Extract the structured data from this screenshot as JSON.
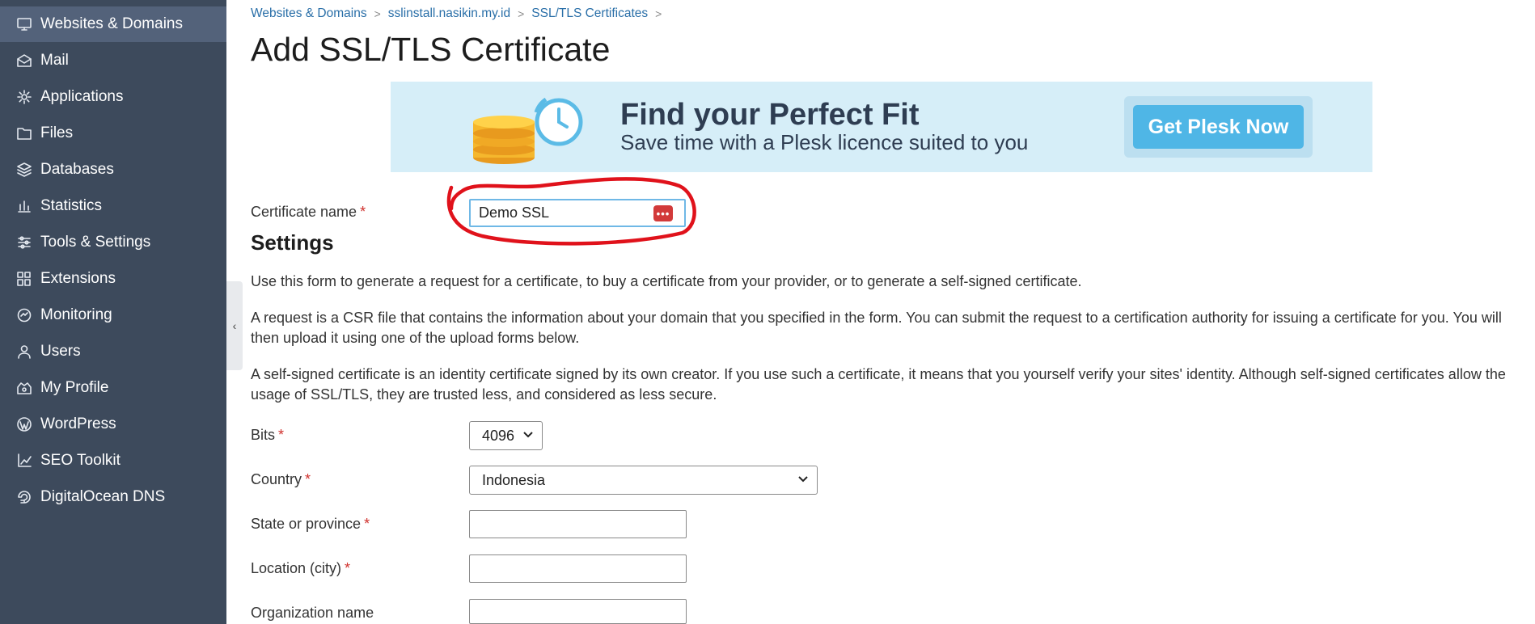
{
  "sidebar": {
    "items": [
      {
        "label": "Websites & Domains",
        "icon": "monitor-icon"
      },
      {
        "label": "Mail",
        "icon": "mail-icon"
      },
      {
        "label": "Applications",
        "icon": "gear-icon"
      },
      {
        "label": "Files",
        "icon": "folder-icon"
      },
      {
        "label": "Databases",
        "icon": "database-icon"
      },
      {
        "label": "Statistics",
        "icon": "bar-chart-icon"
      },
      {
        "label": "Tools & Settings",
        "icon": "sliders-icon"
      },
      {
        "label": "Extensions",
        "icon": "puzzle-icon"
      },
      {
        "label": "Monitoring",
        "icon": "monitoring-icon"
      },
      {
        "label": "Users",
        "icon": "user-icon"
      },
      {
        "label": "My Profile",
        "icon": "profile-icon"
      },
      {
        "label": "WordPress",
        "icon": "wordpress-icon"
      },
      {
        "label": "SEO Toolkit",
        "icon": "seo-chart-icon"
      },
      {
        "label": "DigitalOcean DNS",
        "icon": "digitalocean-icon"
      }
    ]
  },
  "breadcrumb": {
    "items": [
      "Websites & Domains",
      "sslinstall.nasikin.my.id",
      "SSL/TLS Certificates"
    ],
    "separator": ">"
  },
  "page": {
    "title": "Add SSL/TLS Certificate"
  },
  "banner": {
    "title": "Find your Perfect Fit",
    "subtitle": "Save time with a Plesk licence suited to you",
    "button": "Get Plesk Now"
  },
  "form": {
    "required_mark": "*",
    "certificate_name": {
      "label": "Certificate name",
      "value": "Demo SSL"
    },
    "settings_title": "Settings",
    "paragraphs": [
      "Use this form to generate a request for a certificate, to buy a certificate from your provider, or to generate a self-signed certificate.",
      "A request is a CSR file that contains the information about your domain that you specified in the form. You can submit the request to a certification authority for issuing a certificate for you. You will then upload it using one of the upload forms below.",
      "A self-signed certificate is an identity certificate signed by its own creator. If you use such a certificate, it means that you yourself verify your sites' identity. Although self-signed certificates allow the usage of SSL/TLS, they are trusted less, and considered as less secure."
    ],
    "bits": {
      "label": "Bits",
      "value": "4096"
    },
    "country": {
      "label": "Country",
      "value": "Indonesia"
    },
    "state": {
      "label": "State or province",
      "value": ""
    },
    "location": {
      "label": "Location (city)",
      "value": ""
    },
    "organization": {
      "label": "Organization name",
      "value": ""
    }
  },
  "colors": {
    "sidebar_bg": "#3d4a5c",
    "sidebar_active": "#53627a",
    "link": "#2a6fa8",
    "required": "#d0312d",
    "banner_bg": "#d6eef8",
    "banner_button": "#4fb6e6",
    "annotation": "#e0121b"
  }
}
